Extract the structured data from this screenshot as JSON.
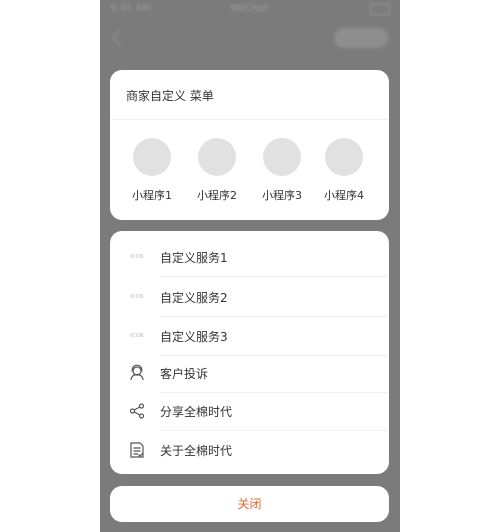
{
  "status_bar": {
    "time": "9:41 AM",
    "carrier": "WeChat"
  },
  "menu": {
    "title": "商家自定义 菜单",
    "mini_programs": [
      {
        "label": "小程序1"
      },
      {
        "label": "小程序2"
      },
      {
        "label": "小程序3"
      },
      {
        "label": "小程序4"
      }
    ],
    "items": [
      {
        "label": "自定义服务1",
        "icon_text": "ICON",
        "icon": "placeholder-icon"
      },
      {
        "label": "自定义服务2",
        "icon_text": "ICON",
        "icon": "placeholder-icon"
      },
      {
        "label": "自定义服务3",
        "icon_text": "ICON",
        "icon": "placeholder-icon"
      },
      {
        "label": "客户投诉",
        "icon": "customer-service-icon"
      },
      {
        "label": "分享全棉时代",
        "icon": "share-icon"
      },
      {
        "label": "关于全棉时代",
        "icon": "about-icon"
      }
    ],
    "close_label": "关闭"
  },
  "colors": {
    "overlay": "#7b7b7b",
    "card": "#ffffff",
    "placeholder_circle": "#e1e1e1",
    "close_text": "#e06a2c",
    "text": "#333333"
  }
}
